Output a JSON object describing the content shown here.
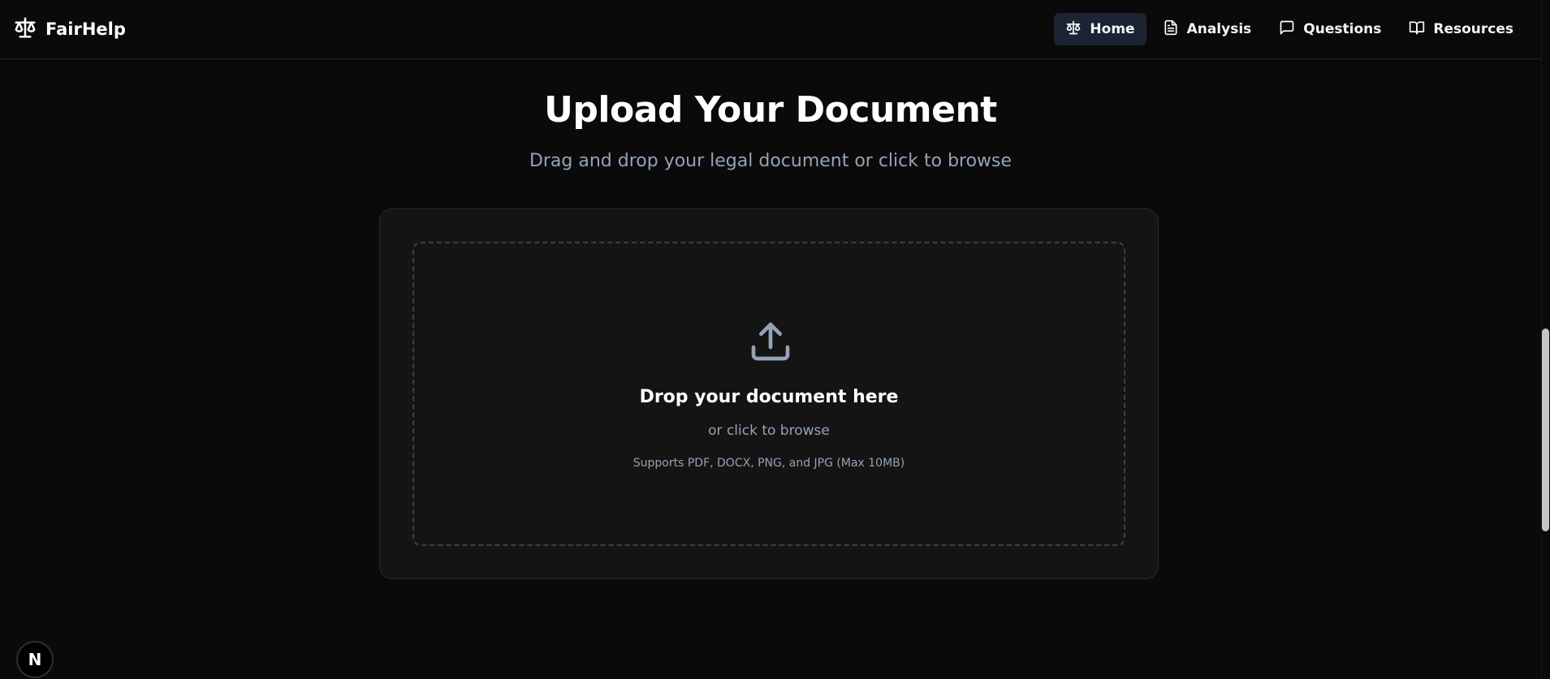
{
  "brand": {
    "name": "FairHelp",
    "icon": "scale-icon"
  },
  "nav": {
    "items": [
      {
        "label": "Home",
        "icon": "scale-icon",
        "active": true
      },
      {
        "label": "Analysis",
        "icon": "document-icon",
        "active": false
      },
      {
        "label": "Questions",
        "icon": "chat-bubble-icon",
        "active": false
      },
      {
        "label": "Resources",
        "icon": "book-open-icon",
        "active": false
      }
    ]
  },
  "header": {
    "title": "Upload Your Document",
    "subtitle": "Drag and drop your legal document or click to browse"
  },
  "dropzone": {
    "icon": "upload-icon",
    "title": "Drop your document here",
    "subtitle": "or click to browse",
    "note": "Supports PDF, DOCX, PNG, and JPG (Max 10MB)"
  },
  "dev_indicator": {
    "label": "N",
    "icon": "nextjs-icon"
  },
  "colors": {
    "background": "#0a0a0a",
    "card": "#141414",
    "muted_text": "#94a3b8",
    "active_nav": "#1c2433"
  }
}
